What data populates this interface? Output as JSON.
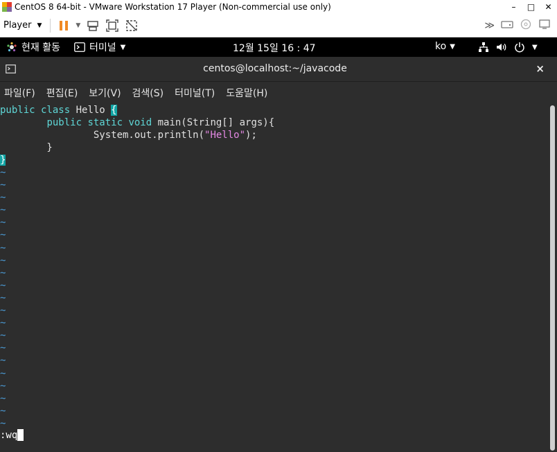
{
  "window": {
    "title": "CentOS 8 64-bit - VMware Workstation 17 Player (Non-commercial use only)",
    "controls": {
      "minimize": "–",
      "maximize": "□",
      "close": "✕"
    }
  },
  "vm_toolbar": {
    "player_label": "Player",
    "icons": [
      "pause-icon",
      "send-keys-icon",
      "fit-guest-icon",
      "unity-icon",
      "fullscreen-icon",
      "devices-icon"
    ]
  },
  "gnome_bar": {
    "activities": "현재 활동",
    "app_menu": "터미널",
    "clock": "12월 15일  16 : 47",
    "keyboard": "ko"
  },
  "terminal": {
    "title": "centos@localhost:~/javacode",
    "close": "×",
    "menu": [
      "파일(F)",
      "편집(E)",
      "보기(V)",
      "검색(S)",
      "터미널(T)",
      "도움말(H)"
    ],
    "code": {
      "l1_kw": "public class",
      "l1_name": " Hello ",
      "l1_brace": "{",
      "l2_indent": "        ",
      "l2_kw": "public static void",
      "l2_rest": " main(String[] args){",
      "l3_indent": "                ",
      "l3_call": "System.out.println(",
      "l3_str": "\"Hello\"",
      "l3_end": ");",
      "l4": "        }",
      "l5_brace": "}"
    },
    "tilde": "~",
    "command": ":wq"
  },
  "colors": {
    "terminal_bg": "#2d2d2d",
    "keyword": "#5fd7d7",
    "string": "#e589e5",
    "tilde": "#4b9bd6",
    "brace_highlight": "#12a5a5",
    "pause_orange": "#f08a24"
  }
}
